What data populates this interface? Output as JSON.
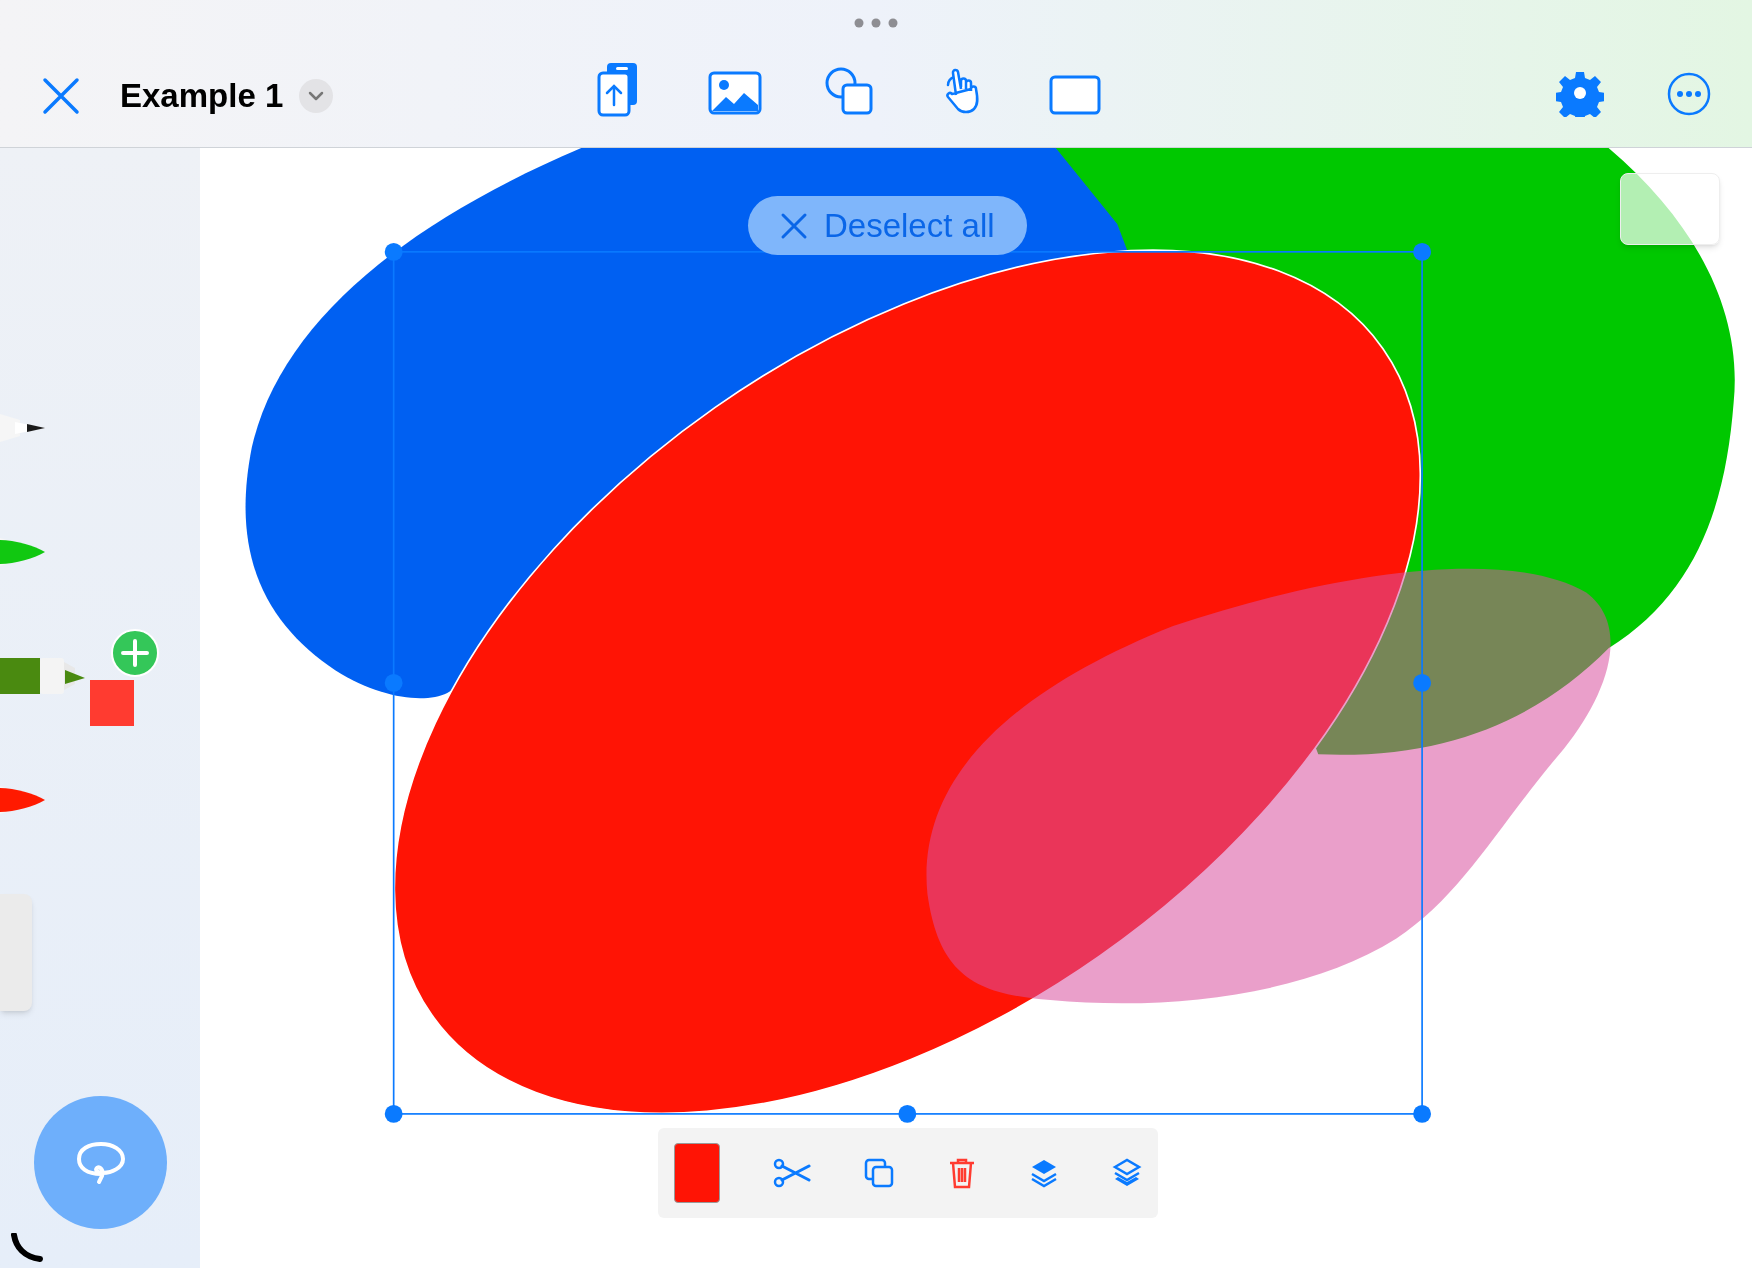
{
  "window": {
    "title": "Example 1"
  },
  "tools": [
    {
      "kind": "pencil",
      "color": "#1a1a1a",
      "selected": false
    },
    {
      "kind": "pen",
      "color": "#11c811",
      "selected": false
    },
    {
      "kind": "marker",
      "color": "#4a8a10",
      "selected": true
    },
    {
      "kind": "brush",
      "color": "#ff1a00",
      "selected": false
    }
  ],
  "selection": {
    "action": "Deselect all"
  }
}
